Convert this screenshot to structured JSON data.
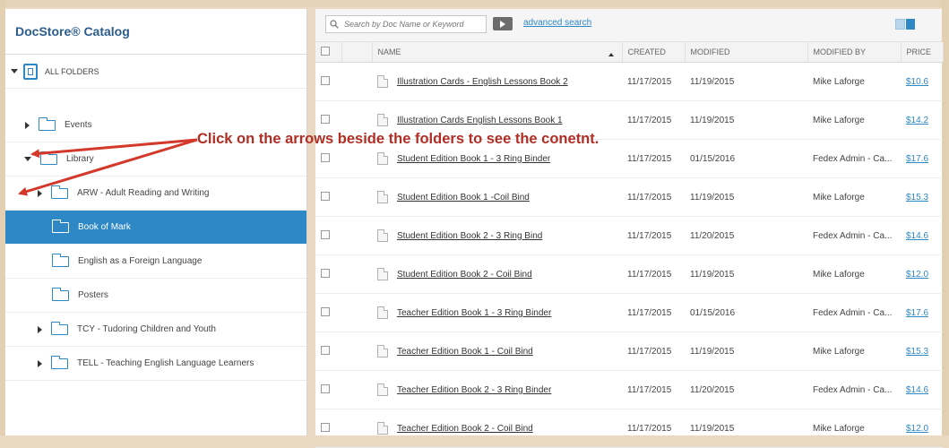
{
  "catalog": {
    "title": "DocStore® Catalog"
  },
  "tree": {
    "all_folders": "ALL FOLDERS",
    "events": "Events",
    "library": "Library",
    "arw": "ARW - Adult Reading and Writing",
    "book_of_mark": "Book of Mark",
    "efl": "English as a Foreign Language",
    "posters": "Posters",
    "tcy": "TCY - Tudoring Children and Youth",
    "tell": "TELL - Teaching English Language Learners"
  },
  "search": {
    "placeholder": "Search by Doc Name or Keyword",
    "advanced": "advanced search"
  },
  "table": {
    "headers": {
      "name": "NAME",
      "created": "CREATED",
      "modified": "MODIFIED",
      "modified_by": "MODIFIED BY",
      "price": "PRICE"
    },
    "rows": [
      {
        "name": "Illustration Cards - English Lessons Book 2",
        "created": "11/17/2015",
        "modified": "11/19/2015",
        "by": "Mike Laforge",
        "price": "$10.6"
      },
      {
        "name": "Illustration Cards English Lessons Book 1",
        "created": "11/17/2015",
        "modified": "11/19/2015",
        "by": "Mike Laforge",
        "price": "$14.2"
      },
      {
        "name": "Student Edition Book 1 - 3 Ring Binder",
        "created": "11/17/2015",
        "modified": "01/15/2016",
        "by": "Fedex Admin - Ca...",
        "price": "$17.6"
      },
      {
        "name": "Student Edition Book 1 -Coil Bind",
        "created": "11/17/2015",
        "modified": "11/19/2015",
        "by": "Mike Laforge",
        "price": "$15.3"
      },
      {
        "name": "Student Edition Book 2 - 3 Ring Bind",
        "created": "11/17/2015",
        "modified": "11/20/2015",
        "by": "Fedex Admin - Ca...",
        "price": "$14.6"
      },
      {
        "name": "Student Edition Book 2 - Coil Bind",
        "created": "11/17/2015",
        "modified": "11/19/2015",
        "by": "Mike Laforge",
        "price": "$12.0"
      },
      {
        "name": "Teacher Edition Book 1 - 3 Ring Binder",
        "created": "11/17/2015",
        "modified": "01/15/2016",
        "by": "Fedex Admin - Ca...",
        "price": "$17.6"
      },
      {
        "name": "Teacher Edition Book 1 - Coil Bind",
        "created": "11/17/2015",
        "modified": "11/19/2015",
        "by": "Mike Laforge",
        "price": "$15.3"
      },
      {
        "name": "Teacher Edition Book 2 - 3 Ring Binder",
        "created": "11/17/2015",
        "modified": "11/20/2015",
        "by": "Fedex Admin - Ca...",
        "price": "$14.6"
      },
      {
        "name": "Teacher Edition Book 2 - Coil Bind",
        "created": "11/17/2015",
        "modified": "11/19/2015",
        "by": "Mike Laforge",
        "price": "$12.0"
      }
    ]
  },
  "annotation": {
    "text": "Click on the arrows beside the folders to see the conetnt.",
    "color": "#b12e25"
  },
  "colors": {
    "accent": "#2e88c5",
    "title": "#2b5c8c"
  }
}
